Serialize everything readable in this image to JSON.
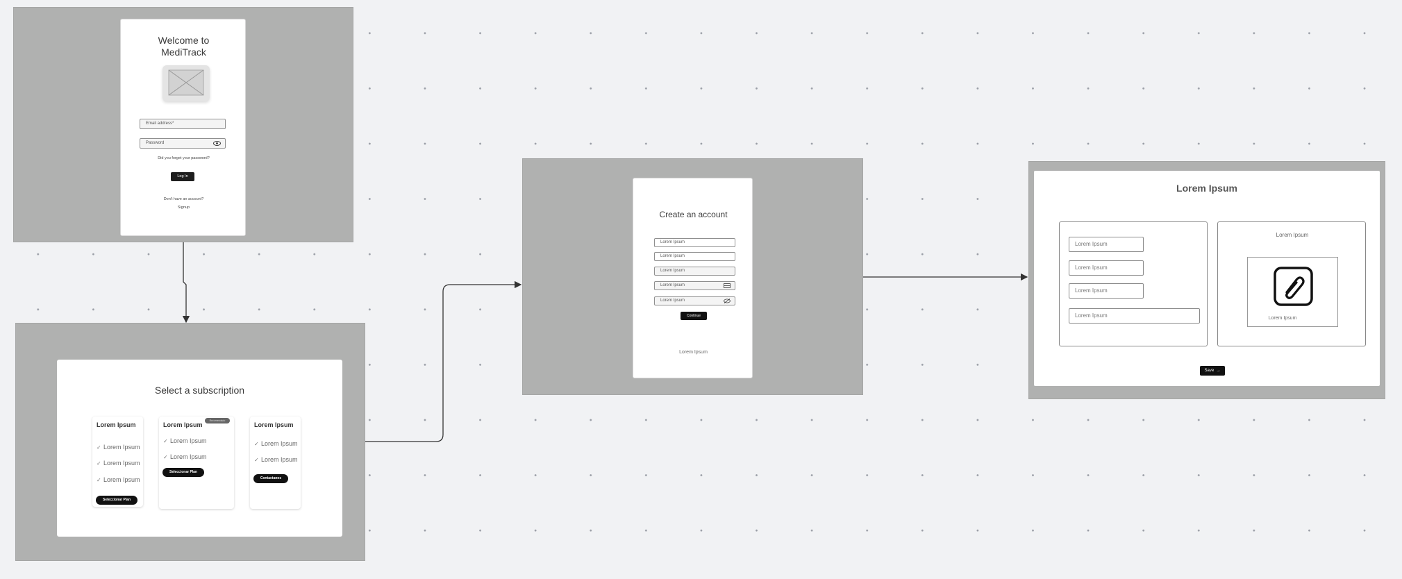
{
  "login": {
    "title_line1": "Welcome to",
    "title_line2": "MediTrack",
    "email_placeholder": "Email address*",
    "password_placeholder": "Password",
    "forgot": "Did you forget your password?",
    "login_button": "Log In",
    "no_account": "Don't have an account?",
    "signup": "Signup"
  },
  "subscription": {
    "title": "Select a subscription",
    "plans": [
      {
        "name": "Lorem Ipsum",
        "features": [
          "Lorem Ipsum",
          "Lorem Ipsum",
          "Lorem Ipsum"
        ],
        "button": "Seleccionar Plan",
        "badge": ""
      },
      {
        "name": "Lorem Ipsum",
        "features": [
          "Lorem Ipsum",
          "Lorem Ipsum"
        ],
        "button": "Seleccionar Plan",
        "badge": "Recomendado"
      },
      {
        "name": "Lorem Ipsum",
        "features": [
          "Lorem Ipsum",
          "Lorem Ipsum"
        ],
        "button": "Contactanos",
        "badge": ""
      }
    ]
  },
  "create_account": {
    "title": "Create an account",
    "fields": [
      "Lorem Ipsum",
      "Lorem Ipsum",
      "Lorem Ipsum",
      "Lorem Ipsum",
      "Lorem Ipsum"
    ],
    "continue_button": "Continue",
    "footer": "Lorem Ipsum"
  },
  "details": {
    "title": "Lorem Ipsum",
    "left_fields": [
      "Lorem Ipsum",
      "Lorem Ipsum",
      "Lorem Ipsum",
      "Lorem Ipsum"
    ],
    "right_label": "Lorem Ipsum",
    "upload_caption": "Lorem Ipsum",
    "save_button": "Save"
  },
  "icons": {
    "image_placeholder": "image-placeholder-icon",
    "eye": "eye-icon",
    "eye_closed": "eye-closed-icon",
    "check": "check-icon",
    "paperclip": "paperclip-icon",
    "arrow": "arrow-right-icon"
  },
  "colors": {
    "canvas": "#f1f2f4",
    "frame": "#b0b1b0",
    "card": "#ffffff",
    "button": "#111111"
  }
}
